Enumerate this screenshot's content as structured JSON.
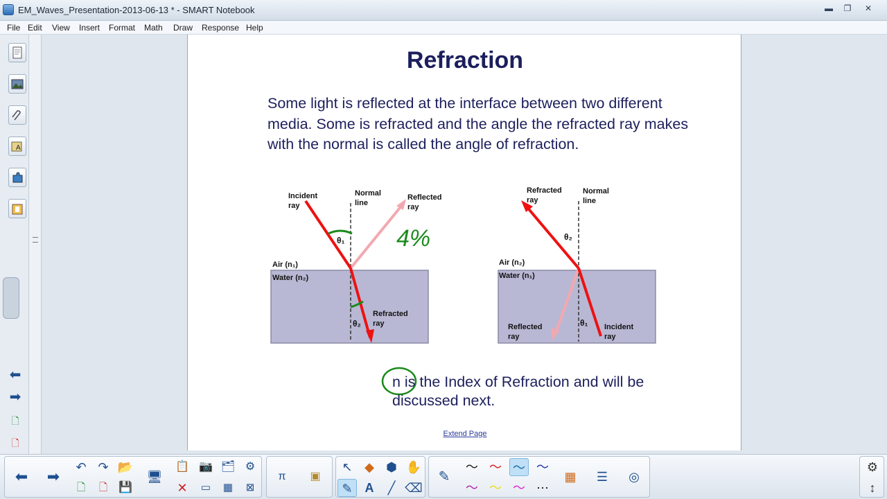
{
  "window": {
    "title": "EM_Waves_Presentation-2013-06-13 * - SMART Notebook",
    "controls": [
      "▬",
      "❐",
      "✕"
    ]
  },
  "menu": [
    "File",
    "Edit",
    "View",
    "Insert",
    "Format",
    "Math",
    "Draw",
    "Response",
    "Help"
  ],
  "slide": {
    "title": "Refraction",
    "body": "Some light is reflected at the interface between two different media.  Some is refracted and the angle the refracted ray makes with the normal is called the angle of refraction.",
    "footnote": "n is the Index of Refraction and will be discussed next.",
    "extend_link": "Extend Page",
    "handwritten_note": "4%",
    "diagram_left": {
      "incident": "Incident\nray",
      "normal": "Normal\nline",
      "reflected": "Reflected\nray",
      "theta1": "θ₁",
      "air": "Air (n₁)",
      "water": "Water (n₂)",
      "refracted": "Refracted\nray",
      "theta2": "θ₂"
    },
    "diagram_right": {
      "refracted": "Refracted\nray",
      "normal": "Normal\nline",
      "theta2": "θ₂",
      "air": "Air (n₂)",
      "water": "Water (n₁)",
      "reflected": "Reflected\nray",
      "theta1": "θ₁",
      "incident": "Incident\nray"
    }
  },
  "colors": {
    "slide_text": "#1c1f5c",
    "ray_red": "#ee1111",
    "ray_pink": "#f2a8b0",
    "water_fill": "#b8b8d4",
    "ink_green": "#1a8a1a",
    "link_blue": "#2b3a9c"
  },
  "icons": {
    "side_tabs": [
      "page-sorter-icon",
      "gallery-icon",
      "attachments-icon",
      "properties-icon",
      "addons-icon",
      "lesson-activity-icon"
    ],
    "nav": [
      "back-arrow-icon",
      "forward-arrow-icon",
      "add-page-icon",
      "delete-page-icon"
    ]
  }
}
